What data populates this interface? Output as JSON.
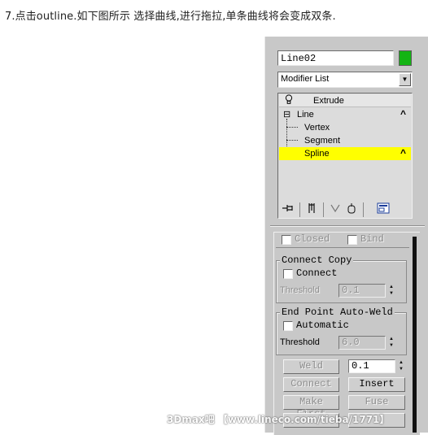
{
  "caption": "7.点击outline.如下图所示 选择曲线,进行拖拉,单条曲线将会变成双条.",
  "object_name": "Line02",
  "object_color": "#14b414",
  "modifier_list": {
    "label": "Modifier List",
    "arrow": "▼"
  },
  "stack": {
    "extrude": {
      "icon": "lightbulb-icon",
      "label": "Extrude"
    },
    "line": {
      "expander": "⊟",
      "label": "Line",
      "chevron": "^"
    },
    "sub_items": [
      {
        "label": "Vertex"
      },
      {
        "label": "Segment"
      },
      {
        "label": "Spline",
        "selected": true,
        "chevron": "^"
      }
    ]
  },
  "toolbar": {
    "pin": "pin-stack-icon",
    "show_end": "show-end-result-icon",
    "make_unique": "make-unique-icon",
    "remove_modifier": "remove-modifier-icon",
    "configure": "configure-modifier-sets-icon"
  },
  "top_row": {
    "closed": "Closed",
    "bind": "Bind"
  },
  "connect_copy": {
    "title": "Connect Copy",
    "connect_label": "Connect",
    "threshold_label": "Threshold",
    "threshold_value": "0.1"
  },
  "auto_weld": {
    "title": "End Point Auto-Weld",
    "automatic_label": "Automatic",
    "threshold_label": "Threshold",
    "threshold_value": "6.0"
  },
  "buttons": {
    "weld": "Weld",
    "weld_value": "0.1",
    "connect": "Connect",
    "insert": "Insert",
    "make_first": "Make First",
    "fuse": "Fuse"
  },
  "watermark": "3Dmax吧 【www.lineco.com/tieba/1771】"
}
